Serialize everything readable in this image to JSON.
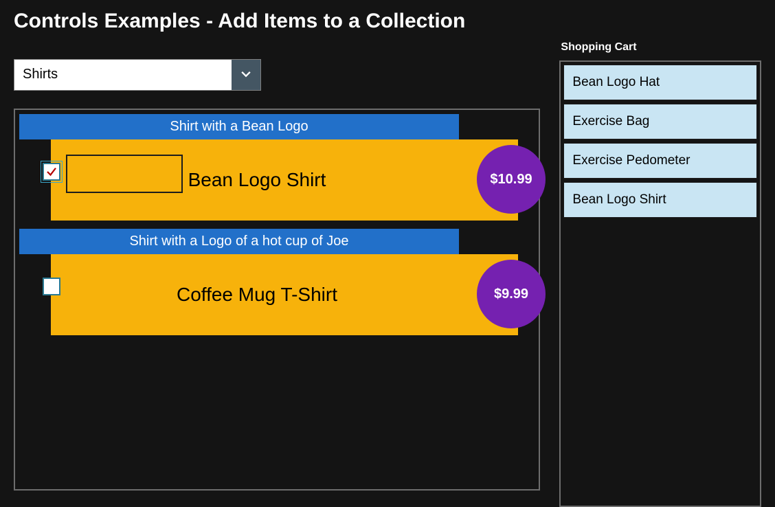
{
  "page_title": "Controls Examples - Add Items to a Collection",
  "dropdown": {
    "selected": "Shirts"
  },
  "products": [
    {
      "header": "Shirt with a Bean Logo",
      "name": "Bean Logo Shirt",
      "price": "$10.99",
      "checked": true,
      "focused": true
    },
    {
      "header": "Shirt with a Logo of a hot cup of Joe",
      "name": "Coffee Mug T-Shirt",
      "price": "$9.99",
      "checked": false,
      "focused": false
    }
  ],
  "cart": {
    "title": "Shopping Cart",
    "items": [
      "Bean Logo Hat",
      "Exercise Bag",
      "Exercise Pedometer",
      "Bean Logo Shirt"
    ]
  },
  "colors": {
    "accent_blue": "#2270c9",
    "accent_gold": "#f7b20b",
    "accent_purple": "#7521b0",
    "cart_item_bg": "#c9e5f3"
  }
}
